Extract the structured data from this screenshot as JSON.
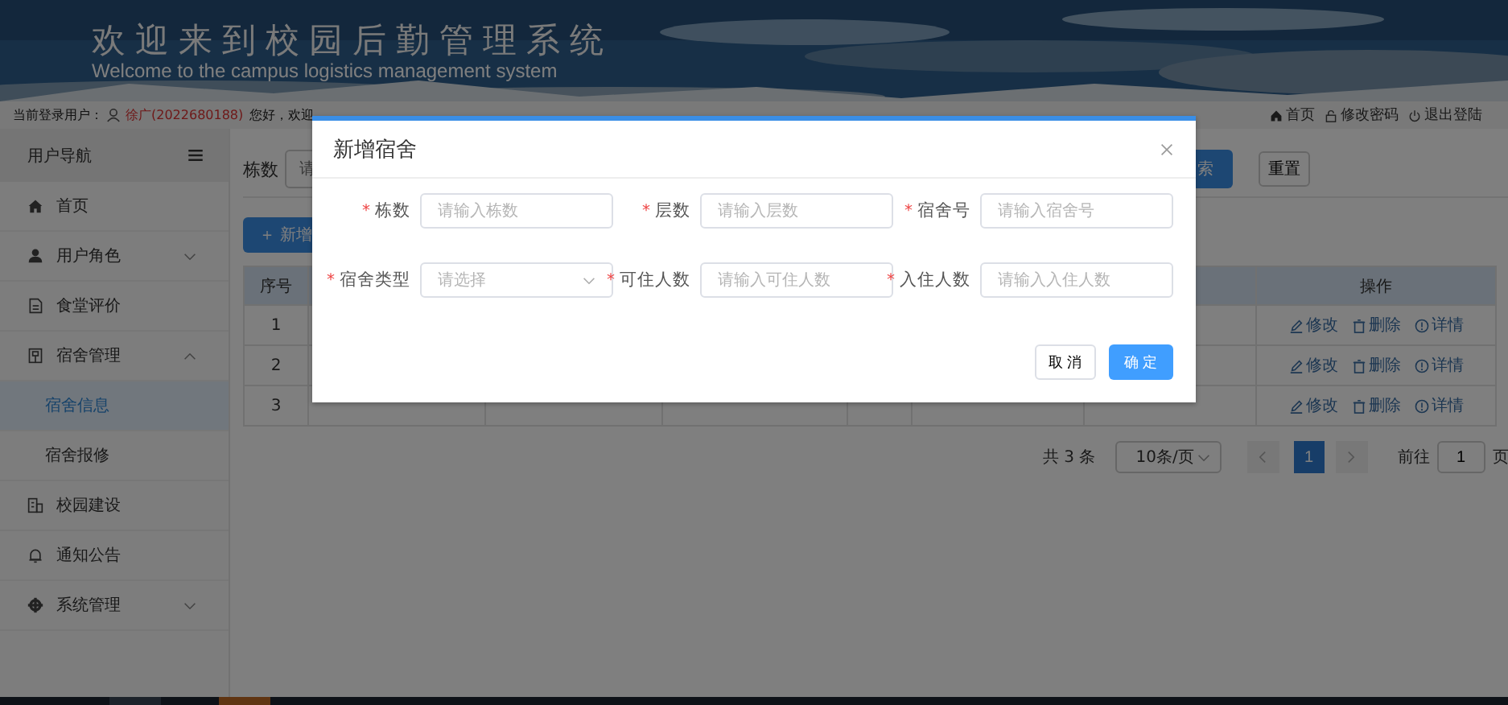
{
  "header": {
    "title": "欢迎来到校园后勤管理系统",
    "subtitle": "Welcome to the campus logistics management system"
  },
  "user_bar": {
    "label": "当前登录用户：",
    "user": "徐广(2022680188)",
    "greeting": "您好，欢迎",
    "links": [
      "首页",
      "修改密码",
      "退出登陆"
    ]
  },
  "sidebar": {
    "title": "用户导航",
    "items": [
      {
        "label": "首页",
        "selected": false
      },
      {
        "label": "用户角色",
        "selected": false,
        "expanded": false
      },
      {
        "label": "食堂评价",
        "selected": false
      },
      {
        "label": "宿舍管理",
        "selected": false,
        "expanded": true,
        "children": [
          {
            "label": "宿舍信息",
            "selected": true
          },
          {
            "label": "宿舍报修",
            "selected": false
          }
        ]
      },
      {
        "label": "校园建设",
        "selected": false
      },
      {
        "label": "通知公告",
        "selected": false
      },
      {
        "label": "系统管理",
        "selected": false,
        "expanded": false
      }
    ]
  },
  "search": {
    "label": "栋数",
    "placeholder": "请",
    "search_button": "索",
    "reset_button": "重置"
  },
  "add_button": {
    "icon": "＋",
    "label": "新增"
  },
  "table": {
    "columns": [
      "序号",
      "操作"
    ],
    "rows": [
      {
        "index": "1",
        "actions": [
          "修改",
          "删除",
          "详情"
        ]
      },
      {
        "index": "2",
        "actions": [
          "修改",
          "删除",
          "详情"
        ]
      },
      {
        "index": "3",
        "actions": [
          "修改",
          "删除",
          "详情"
        ]
      }
    ]
  },
  "pagination": {
    "total": "共 3 条",
    "page_size": "10条/页",
    "pages": [
      {
        "label": "1",
        "selected": true
      }
    ],
    "goto_label": "前往",
    "goto_value": "1",
    "goto_suffix": "页"
  },
  "dialog": {
    "title": "新增宿舍",
    "fields": [
      {
        "mark": "*",
        "label": "栋数",
        "placeholder": "请输入栋数",
        "kind": "input"
      },
      {
        "mark": "*",
        "label": "层数",
        "placeholder": "请输入层数",
        "kind": "input"
      },
      {
        "mark": "*",
        "label": "宿舍号",
        "placeholder": "请输入宿舍号",
        "kind": "input"
      },
      {
        "mark": "*",
        "label": "宿舍类型",
        "placeholder": "请选择",
        "kind": "select"
      },
      {
        "mark": "*",
        "label": "可住人数",
        "placeholder": "请输入可住人数",
        "kind": "input"
      },
      {
        "mark": "*",
        "label": "入住人数",
        "placeholder": "请输入入住人数",
        "kind": "input"
      }
    ],
    "cancel": "取 消",
    "confirm": "确 定"
  }
}
